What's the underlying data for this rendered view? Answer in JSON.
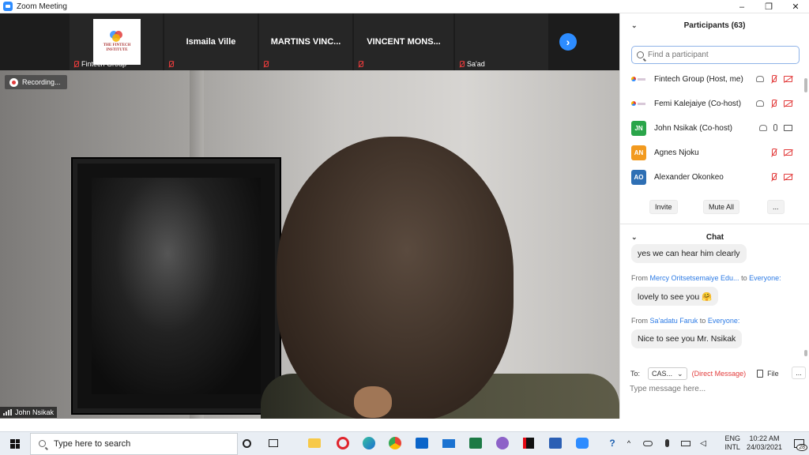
{
  "window": {
    "title": "Zoom Meeting",
    "controls": [
      "–",
      "❐",
      "✕"
    ]
  },
  "thumbnails": [
    {
      "name": "",
      "bottom_label": "Fintech Group",
      "has_logo": true
    },
    {
      "name": "Ismaila Ville",
      "bottom_label": ""
    },
    {
      "name": "MARTINS VINC...",
      "bottom_label": ""
    },
    {
      "name": "VINCENT MONS...",
      "bottom_label": ""
    },
    {
      "name": "",
      "bottom_label": "Sa'ad"
    }
  ],
  "logo": {
    "text": "THE FINTECH INSTITUTE"
  },
  "recording_label": "Recording...",
  "active_speaker": "John Nsikak",
  "participants": {
    "title": "Participants (63)",
    "search_placeholder": "Find a participant",
    "list": [
      {
        "name": "Fintech Group (Host, me)",
        "avatar": "",
        "avatar_color": "#ffffff"
      },
      {
        "name": "Femi Kalejaiye (Co-host)",
        "avatar": "",
        "avatar_color": "#ffffff"
      },
      {
        "name": "John Nsikak (Co-host)",
        "avatar": "JN",
        "avatar_color": "#2aa54a"
      },
      {
        "name": "Agnes Njoku",
        "avatar": "AN",
        "avatar_color": "#f29a1f"
      },
      {
        "name": "Alexander Okonkeo",
        "avatar": "AO",
        "avatar_color": "#2e6fb4"
      }
    ],
    "buttons": {
      "invite": "Invite",
      "mute_all": "Mute All",
      "more": "..."
    }
  },
  "chat": {
    "title": "Chat",
    "messages": [
      {
        "text": "yes we can hear him clearly"
      },
      {
        "from_prefix": "From",
        "sender": "Mercy Oritsetsemaiye Edu...",
        "to_word": "to",
        "recipient": "Everyone:",
        "text": "lovely to see you 🤗"
      },
      {
        "from_prefix": "From",
        "sender": "Sa'adatu Faruk",
        "to_word": "to",
        "recipient": "Everyone:",
        "text": "Nice to see you Mr. Nsikak"
      }
    ],
    "to_label": "To:",
    "to_value": "CAS...",
    "direct_label": "(Direct Message)",
    "file_label": "File",
    "more_label": "...",
    "input_placeholder": "Type message here..."
  },
  "taskbar": {
    "search_placeholder": "Type here to search",
    "lang_top": "ENG",
    "lang_bottom": "INTL",
    "time": "10:22 AM",
    "date": "24/03/2021",
    "notifications": "28"
  },
  "colors": {
    "accent": "#2d8cff",
    "muted": "#e23b3b",
    "link": "#2d7be5"
  }
}
